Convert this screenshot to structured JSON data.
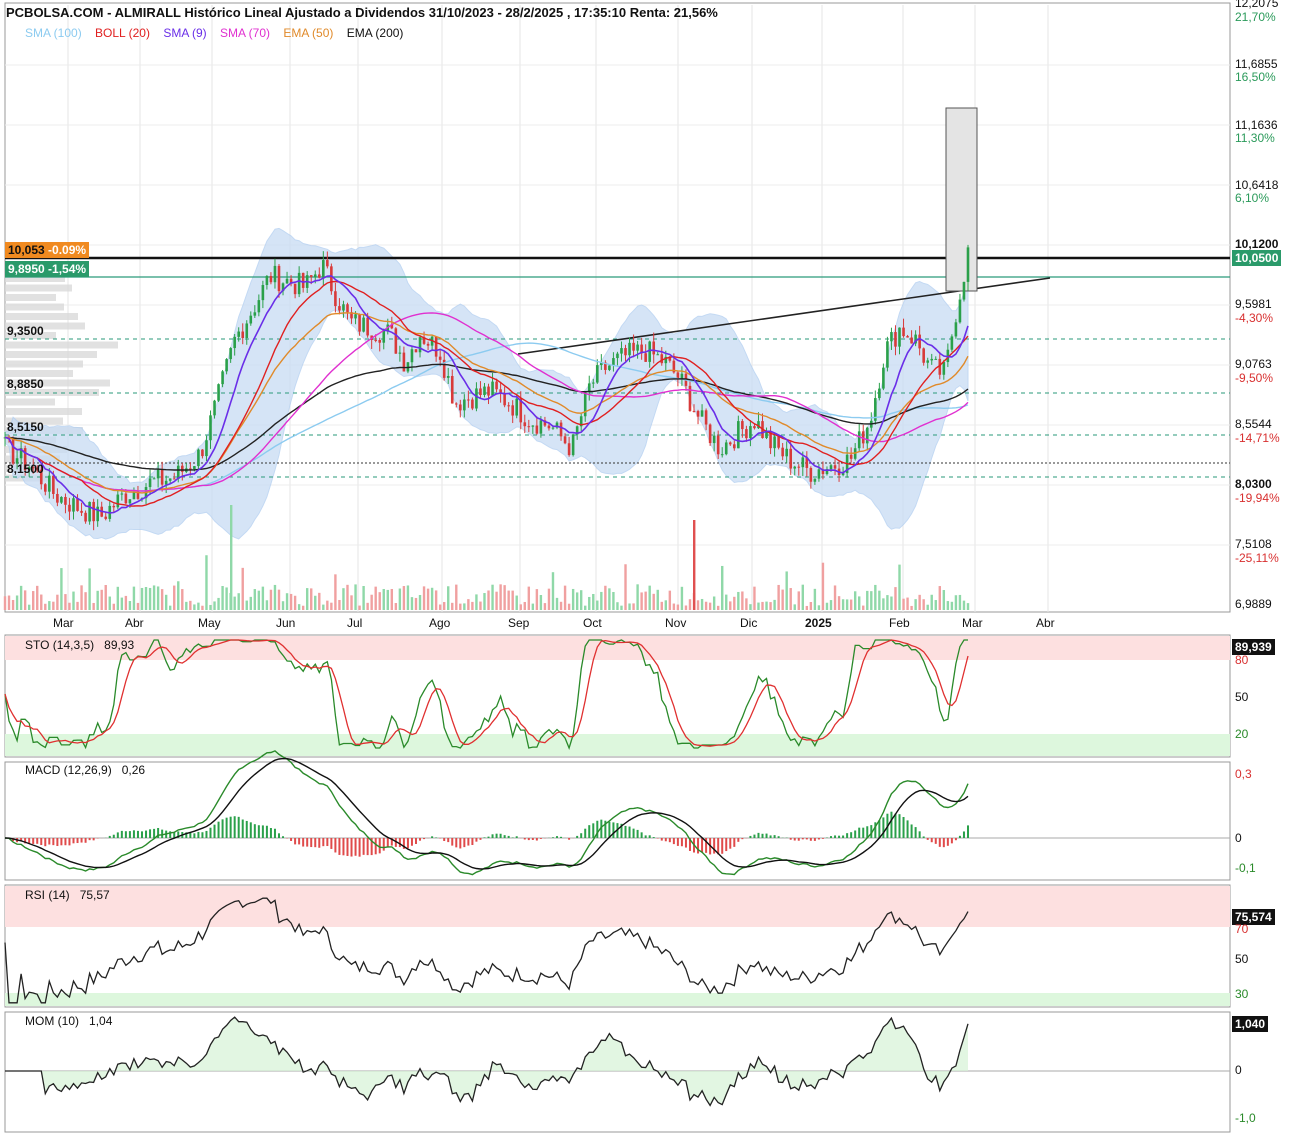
{
  "header": {
    "title": "PCBOLSA.COM - ALMIRALL Histórico Lineal Ajustado a Dividendos 31/10/2023 - 28/2/2025 , 17:35:10 Renta: 21,56%"
  },
  "legend": [
    {
      "label": "SMA (100)",
      "color": "#8ccbf0"
    },
    {
      "label": "BOLL (20)",
      "color": "#e02020"
    },
    {
      "label": "SMA (9)",
      "color": "#6a2ee8"
    },
    {
      "label": "SMA (70)",
      "color": "#e030d0"
    },
    {
      "label": "EMA (50)",
      "color": "#e08a2a"
    },
    {
      "label": "EMA (200)",
      "color": "#111111"
    }
  ],
  "price_axis": [
    {
      "value": "12,2075",
      "pct": "21,70%",
      "pct_color": "#2a9a5a"
    },
    {
      "value": "11,6855",
      "pct": "16,50%",
      "pct_color": "#2a9a5a"
    },
    {
      "value": "11,1636",
      "pct": "11,30%",
      "pct_color": "#2a9a5a"
    },
    {
      "value": "10,6418",
      "pct": "6,10%",
      "pct_color": "#2a9a5a"
    },
    {
      "value": "10,1200",
      "pct": "",
      "pct_color": "#2a9a5a"
    },
    {
      "value": "9,5981",
      "pct": "-4,30%",
      "pct_color": "#d83030"
    },
    {
      "value": "9,0763",
      "pct": "-9,50%",
      "pct_color": "#d83030"
    },
    {
      "value": "8,5544",
      "pct": "-14,71%",
      "pct_color": "#d83030"
    },
    {
      "value": "8,0300",
      "pct": "-19,94%",
      "pct_color": "#d83030"
    },
    {
      "value": "7,5108",
      "pct": "-25,11%",
      "pct_color": "#d83030"
    },
    {
      "value": "6,9889",
      "pct": "",
      "pct_color": "#d83030"
    }
  ],
  "last_price_box": "10,0500",
  "left_tags": {
    "resistance_value": "10,053",
    "resistance_pct": "-0.09%",
    "support_value": "9,8950",
    "support_pct": "-1,54%"
  },
  "level_labels": [
    "9,3500",
    "8,8850",
    "8,5150",
    "8,1500"
  ],
  "months": [
    "Mar",
    "Abr",
    "May",
    "Jun",
    "Jul",
    "Ago",
    "Sep",
    "Oct",
    "Nov",
    "Dic",
    "2025",
    "Feb",
    "Mar",
    "Abr"
  ],
  "panels": {
    "sto": {
      "label": "STO (14,3,5)",
      "value": "89,93",
      "box": "89,939",
      "ticks": [
        "80",
        "50",
        "20"
      ]
    },
    "macd": {
      "label": "MACD (12,26,9)",
      "value": "0,26",
      "ticks": [
        "0,3",
        "0",
        "-0,1"
      ]
    },
    "rsi": {
      "label": "RSI (14)",
      "value": "75,57",
      "box": "75,574",
      "ticks": [
        "70",
        "50",
        "30"
      ]
    },
    "mom": {
      "label": "MOM (10)",
      "value": "1,04",
      "box": "1,040",
      "ticks": [
        "0",
        "-1,0"
      ]
    }
  },
  "chart_data": {
    "type": "line",
    "title": "PCBOLSA.COM - ALMIRALL Histórico Lineal Ajustado a Dividendos 31/10/2023 - 28/2/2025 , 17:35:10 Renta: 21,56%",
    "x": [
      "Mar",
      "Abr",
      "May",
      "Jun",
      "Jul",
      "Ago",
      "Sep",
      "Oct",
      "Nov",
      "Dic",
      "2025",
      "Feb",
      "Mar"
    ],
    "ylim": [
      6.9889,
      12.2075
    ],
    "series": [
      {
        "name": "",
        "values": [
          8.2,
          7.95,
          8.3,
          9.9,
          9.5,
          9.0,
          8.6,
          9.0,
          8.9,
          8.5,
          8.15,
          9.1,
          10.05
        ]
      },
      {
        "name": "SMA (9)",
        "values": [
          8.3,
          7.9,
          8.2,
          9.4,
          9.7,
          9.0,
          8.6,
          9.0,
          9.1,
          8.5,
          8.2,
          8.9,
          9.3
        ]
      },
      {
        "name": "SMA (70)",
        "values": [
          8.3,
          8.2,
          8.2,
          8.6,
          9.0,
          9.3,
          9.1,
          9.0,
          8.8,
          8.7,
          8.6,
          8.7,
          8.8
        ]
      },
      {
        "name": "EMA (200)",
        "values": [
          8.6,
          8.4,
          8.4,
          8.6,
          8.8,
          8.9,
          8.9,
          8.95,
          8.9,
          8.85,
          8.75,
          8.75,
          8.85
        ]
      }
    ]
  }
}
